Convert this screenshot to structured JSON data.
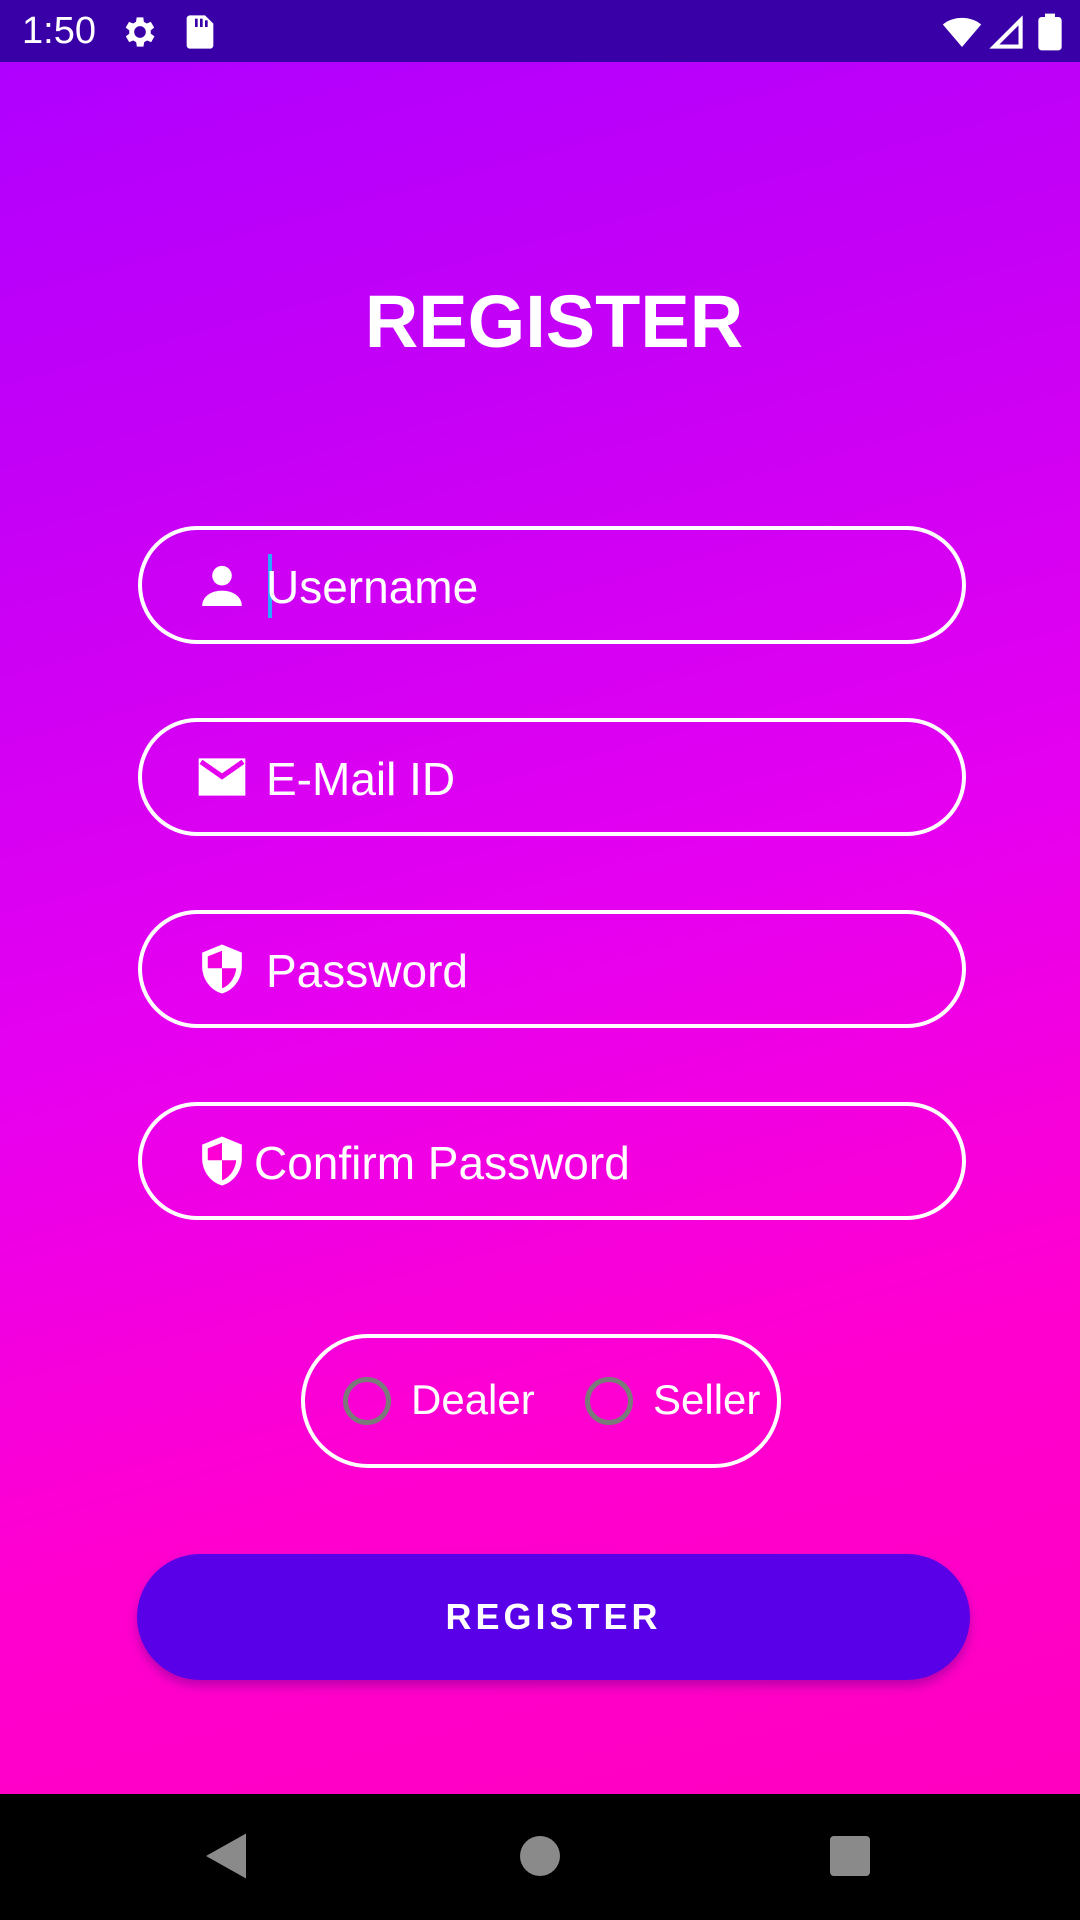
{
  "status_bar": {
    "time": "1:50",
    "icons": [
      "gear-icon",
      "sd-card-icon",
      "wifi-icon",
      "signal-icon",
      "battery-icon"
    ]
  },
  "register_form": {
    "title": "REGISTER",
    "fields": {
      "username": {
        "placeholder": "Username",
        "icon": "person-icon"
      },
      "email": {
        "placeholder": "E-Mail ID",
        "icon": "mail-icon"
      },
      "password": {
        "placeholder": "Password",
        "icon": "shield-icon"
      },
      "confirm_password": {
        "placeholder": "Confirm Password",
        "icon": "shield-icon"
      }
    },
    "role_options": [
      {
        "label": "Dealer",
        "selected": false
      },
      {
        "label": "Seller",
        "selected": false
      }
    ],
    "submit_label": "REGISTER"
  },
  "nav_bar": {
    "buttons": [
      "back-icon",
      "home-icon",
      "recents-icon"
    ]
  },
  "colors": {
    "status_bar": "#3a00a8",
    "gradient_top": "#b000ff",
    "gradient_bottom": "#ff00c0",
    "button": "#5a00e8",
    "cursor": "#28a8ff"
  }
}
